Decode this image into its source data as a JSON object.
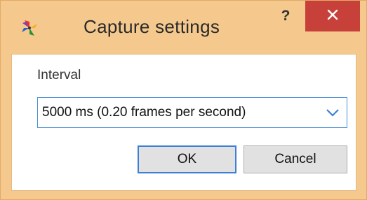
{
  "window": {
    "title": "Capture settings",
    "help_label": "?",
    "close_icon": "close-icon",
    "app_icon": "pinwheel-icon"
  },
  "form": {
    "interval_label": "Interval",
    "interval_value": "5000 ms (0.20 frames per second)"
  },
  "buttons": {
    "ok_label": "OK",
    "cancel_label": "Cancel"
  },
  "colors": {
    "frame": "#f5c98d",
    "close": "#c7413a",
    "focus": "#3c7fd6"
  }
}
